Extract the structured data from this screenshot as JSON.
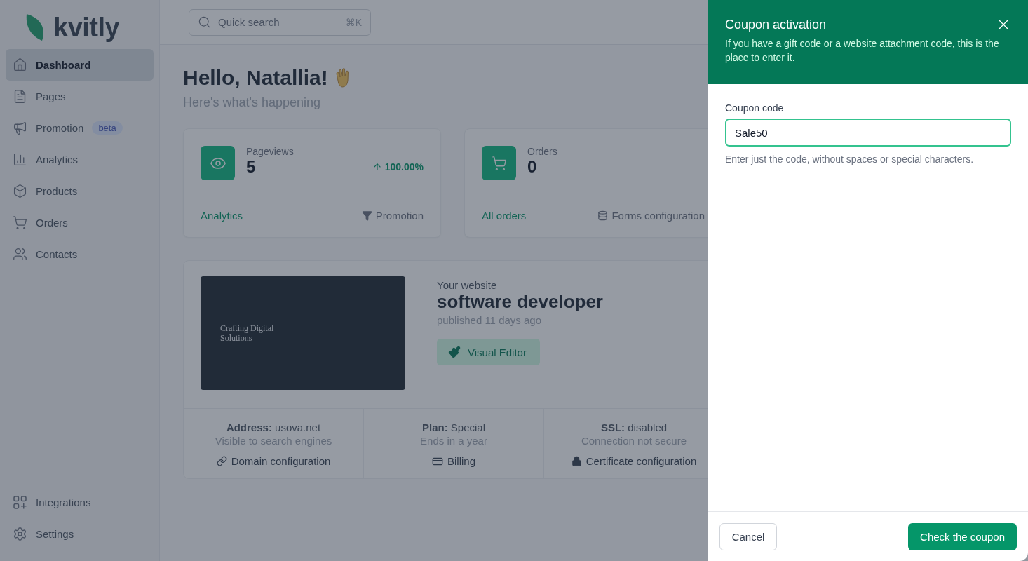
{
  "brand": {
    "name": "kvitly"
  },
  "search": {
    "placeholder": "Quick search",
    "shortcut": "⌘K"
  },
  "sidebar": {
    "items": [
      {
        "kind": "home",
        "label": "Dashboard",
        "selected": true
      },
      {
        "kind": "pages",
        "label": "Pages",
        "selected": false
      },
      {
        "kind": "promotion",
        "label": "Promotion",
        "badge": "beta",
        "selected": false
      },
      {
        "kind": "analytics",
        "label": "Analytics",
        "selected": false
      },
      {
        "kind": "products",
        "label": "Products",
        "selected": false
      },
      {
        "kind": "orders",
        "label": "Orders",
        "selected": false
      },
      {
        "kind": "contacts",
        "label": "Contacts",
        "selected": false
      }
    ],
    "bottom_items": [
      {
        "kind": "integrations",
        "label": "Integrations",
        "selected": false
      },
      {
        "kind": "settings",
        "label": "Settings",
        "selected": false
      }
    ]
  },
  "greeting": {
    "title": "Hello, Natallia!",
    "subtitle": "Here's what's happening"
  },
  "stats": [
    {
      "kind": "pageviews",
      "label": "Pageviews",
      "value": "5",
      "change": "100.00%",
      "link": "Analytics",
      "secondary": "Promotion"
    },
    {
      "kind": "orders",
      "label": "Orders",
      "value": "0",
      "link": "All orders",
      "secondary": "Forms configuration"
    }
  ],
  "website": {
    "preview_heading": "Crafting Digital Solutions",
    "caption": "Your website",
    "name": "software developer",
    "published": "published 11 days ago",
    "editor_button": "Visual Editor",
    "details": [
      {
        "kind": "link",
        "label": "Address:",
        "value": "usova.net",
        "note": "Visible to search engines",
        "action": "Domain configuration"
      },
      {
        "kind": "card",
        "label": "Plan:",
        "value": "Special",
        "note": "Ends in a year",
        "action": "Billing"
      },
      {
        "kind": "lock",
        "label": "SSL:",
        "value": "disabled",
        "note": "Connection not secure",
        "action": "Certificate configuration"
      }
    ]
  },
  "drawer": {
    "title": "Coupon activation",
    "description": "If you have a gift code or a website attachment code, this is the place to enter it.",
    "field_label": "Coupon code",
    "value": "Sale50",
    "hint": "Enter just the code, without spaces or special characters.",
    "cancel": "Cancel",
    "submit": "Check the coupon"
  }
}
